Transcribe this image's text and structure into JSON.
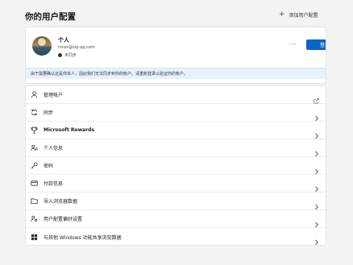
{
  "header": {
    "title": "你的用户配置",
    "add_profile_label": "添加用户配置"
  },
  "profile": {
    "name": "个人",
    "email": "mnxr@vip.qq.com",
    "sync_status": "未同步",
    "more_label": "···",
    "signin_label": "登录",
    "info_text": "由于需要确认这是你本人，因此我们无法同步到你的帐户。请重新登录以验证你的帐户。"
  },
  "menu": {
    "items": [
      {
        "label": "管理帐户",
        "icon": "person-icon",
        "trailing": "external-link"
      },
      {
        "label": "同步",
        "icon": "sync-icon",
        "trailing": "chevron"
      },
      {
        "label": "Microsoft Rewards",
        "icon": "trophy-icon",
        "trailing": "chevron"
      },
      {
        "label": "个人信息",
        "icon": "person-card-icon",
        "trailing": "chevron"
      },
      {
        "label": "密码",
        "icon": "key-icon",
        "trailing": "chevron"
      },
      {
        "label": "付款信息",
        "icon": "credit-card-icon",
        "trailing": "chevron"
      },
      {
        "label": "导入浏览器数据",
        "icon": "folder-import-icon",
        "trailing": "chevron"
      },
      {
        "label": "用户配置偏好设置",
        "icon": "person-settings-icon",
        "trailing": "chevron"
      },
      {
        "label": "与其他 Windows 功能共享浏览数据",
        "icon": "windows-icon",
        "trailing": "chevron"
      }
    ]
  }
}
